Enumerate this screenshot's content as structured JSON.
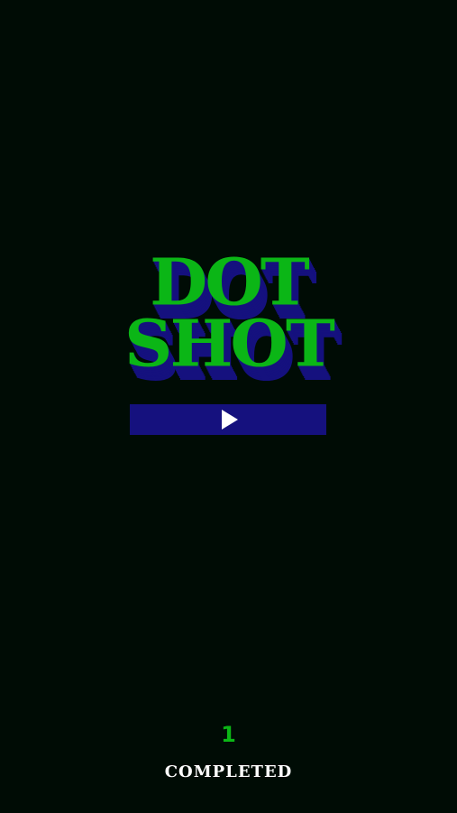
{
  "title": {
    "line1": "DOT",
    "line2": "SHOT"
  },
  "play_button": {
    "icon": "play-icon"
  },
  "stats": {
    "completed_count": "1",
    "completed_label": "COMPLETED"
  },
  "colors": {
    "background": "#000c05",
    "title_green": "#0bb616",
    "title_shadow_blue": "#15117e",
    "button_blue": "#15117e",
    "text_white": "#ffffff"
  }
}
